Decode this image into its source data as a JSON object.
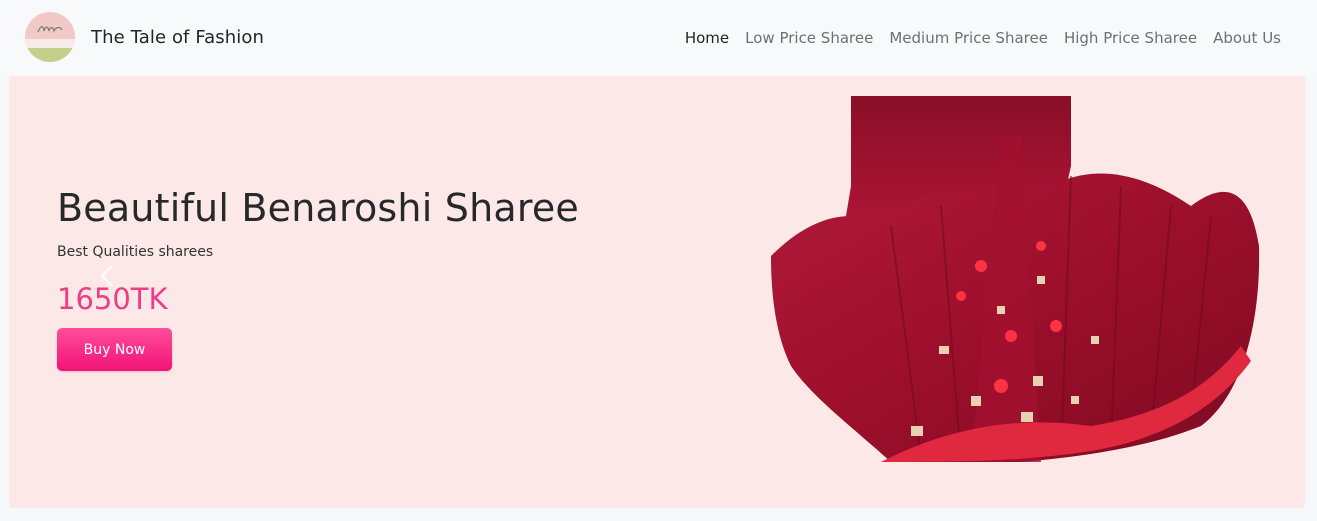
{
  "brand": {
    "name": "The Tale of Fashion",
    "logo_text": "The Tale of Fashion"
  },
  "nav": {
    "items": [
      {
        "label": "Home",
        "active": true
      },
      {
        "label": "Low Price Sharee",
        "active": false
      },
      {
        "label": "Medium Price Sharee",
        "active": false
      },
      {
        "label": "High Price Sharee",
        "active": false
      },
      {
        "label": "About Us",
        "active": false
      }
    ]
  },
  "hero": {
    "title": "Beautiful Benaroshi Sharee",
    "subtitle": "Best Qualities sharees",
    "price": "1650TK",
    "button_label": "Buy Now",
    "background_color": "#fce9e7",
    "accent_color": "#ee3c88",
    "image_icon": "red-saree-image",
    "prev_icon": "chevron-left-icon",
    "next_icon": "chevron-right-icon"
  }
}
